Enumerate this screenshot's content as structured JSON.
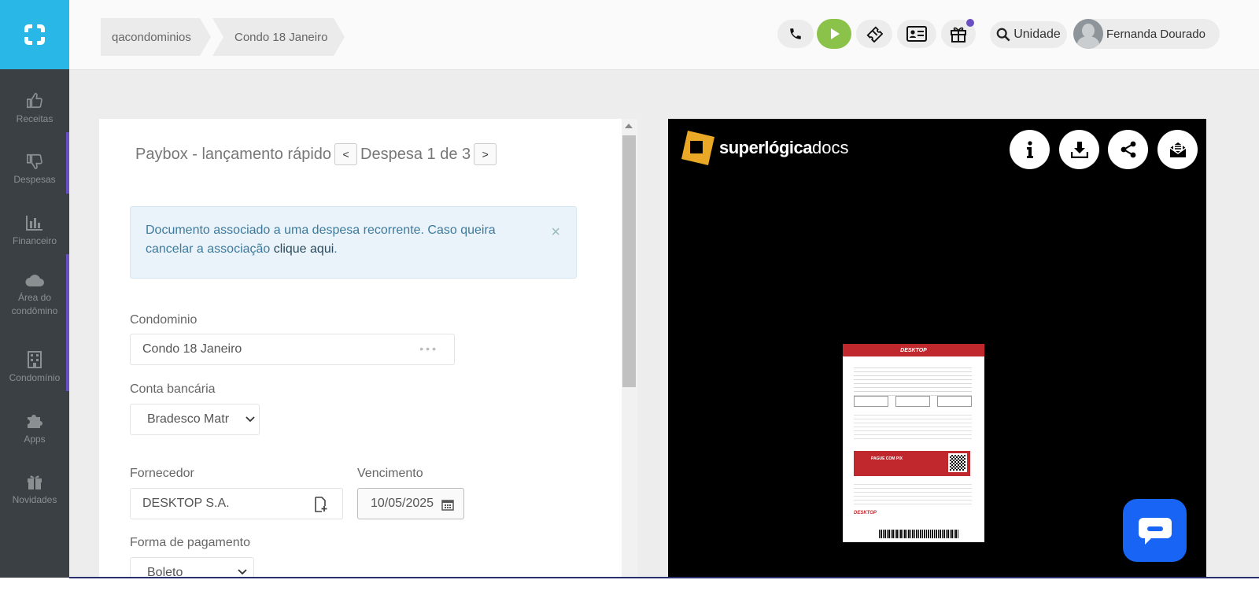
{
  "sidebar": {
    "items": [
      {
        "label": "Receitas",
        "icon": "thumbs-up-icon"
      },
      {
        "label": "Despesas",
        "icon": "thumbs-down-icon"
      },
      {
        "label": "Financeiro",
        "icon": "bar-chart-icon"
      },
      {
        "label": "Área do condômino",
        "icon": "cloud-icon"
      },
      {
        "label": "Condomínio",
        "icon": "building-icon"
      },
      {
        "label": "Apps",
        "icon": "puzzle-icon"
      },
      {
        "label": "Novidades",
        "icon": "gift-icon"
      }
    ]
  },
  "breadcrumb": [
    "qacondominios",
    "Condo 18 Janeiro"
  ],
  "header": {
    "unit_label": "Unidade",
    "user_name": "Fernanda Dourado"
  },
  "form": {
    "title": "Paybox - lançamento rápido",
    "pager_prev": "<",
    "pager_next": ">",
    "pager_text": "Despesa 1 de 3",
    "alert_text": "Documento associado a uma despesa recorrente. Caso queira cancelar a associação ",
    "alert_link": "clique aqui",
    "alert_end": ".",
    "alert_close": "×",
    "condominio_label": "Condominio",
    "condominio_value": "Condo 18 Janeiro",
    "conta_label": "Conta bancária",
    "conta_value": "Bradesco Matr",
    "fornecedor_label": "Fornecedor",
    "fornecedor_value": "DESKTOP S.A.",
    "vencimento_label": "Vencimento",
    "vencimento_value": "10/05/2025",
    "forma_label": "Forma de pagamento",
    "forma_value": "Boleto"
  },
  "viewer": {
    "brand_bold": "superlógica",
    "brand_light": "docs",
    "doc_brand": "DESKTOP",
    "doc_banner": "PAGUE COM PIX"
  },
  "colors": {
    "sidebar_bg": "#3a4044",
    "logo_bg": "#29b7e8",
    "accent": "#6a4fc2",
    "play_green": "#8bc34a",
    "brand_orange": "#e9a825",
    "chat_blue": "#1865f5",
    "doc_red": "#c0282d"
  }
}
